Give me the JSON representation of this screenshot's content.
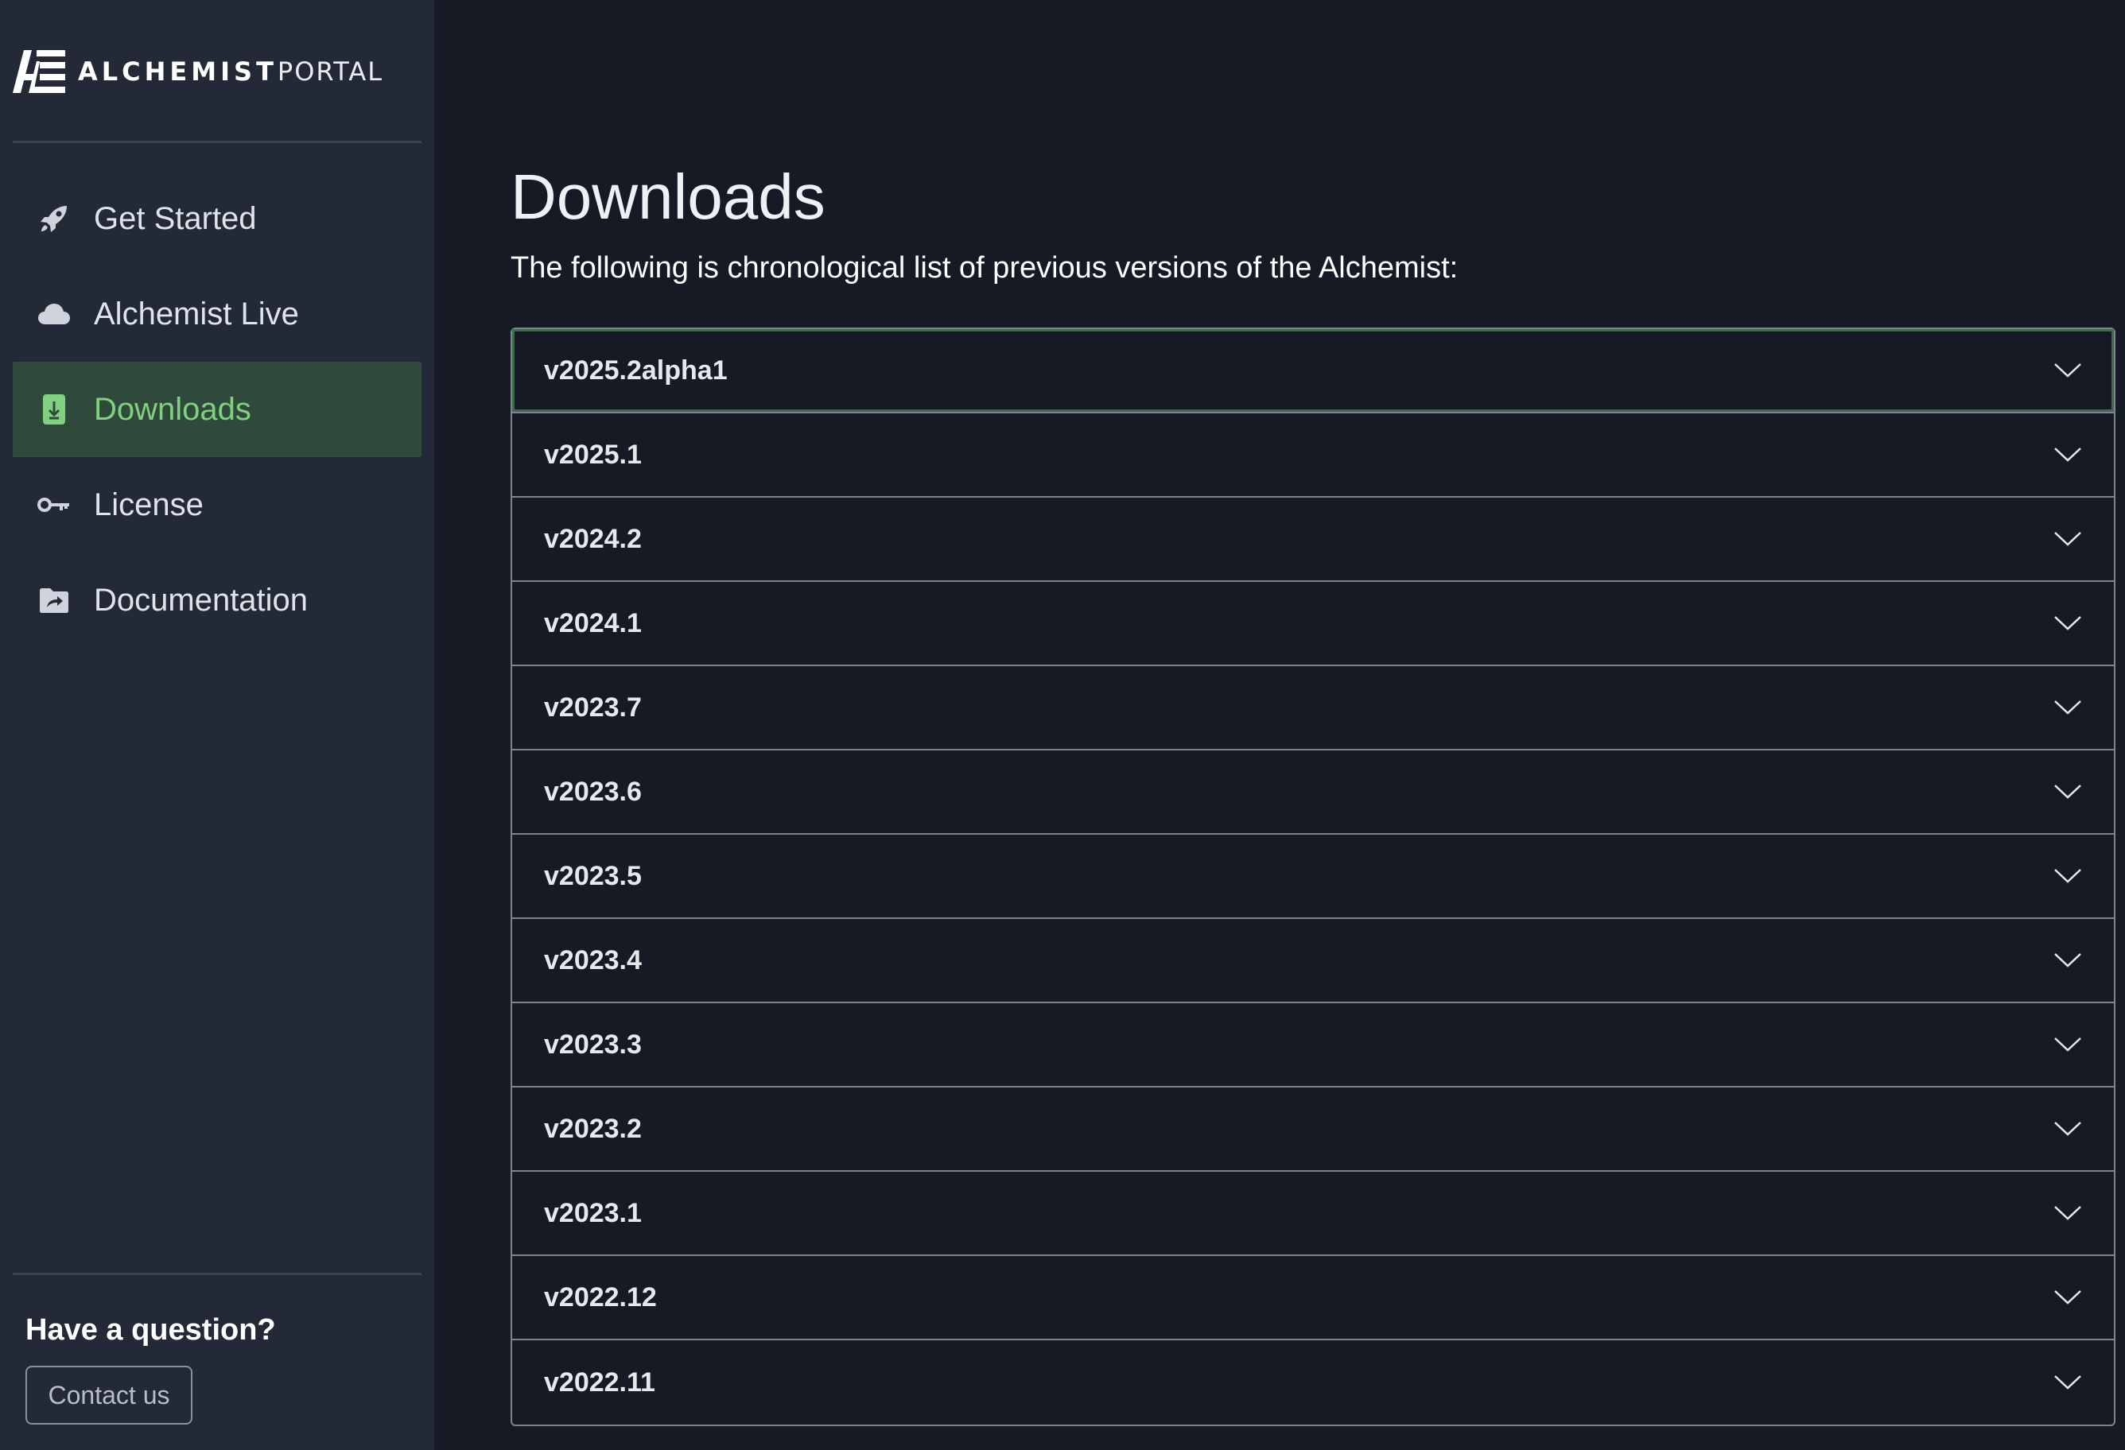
{
  "brand": {
    "name_strong": "ALCHEMIST",
    "name_light": "PORTAL",
    "logo_icon": "alchemist-logo-icon"
  },
  "sidebar": {
    "items": [
      {
        "label": "Get Started",
        "icon": "rocket-icon",
        "active": false
      },
      {
        "label": "Alchemist Live",
        "icon": "cloud-icon",
        "active": false
      },
      {
        "label": "Downloads",
        "icon": "download-file-icon",
        "active": true
      },
      {
        "label": "License",
        "icon": "key-icon",
        "active": false
      },
      {
        "label": "Documentation",
        "icon": "folder-share-icon",
        "active": false
      }
    ],
    "question": "Have a question?",
    "contact_label": "Contact us"
  },
  "main": {
    "title": "Downloads",
    "subtitle": "The following is chronological list of previous versions of the Alchemist:",
    "versions": [
      "v2025.2alpha1",
      "v2025.1",
      "v2024.2",
      "v2024.1",
      "v2023.7",
      "v2023.6",
      "v2023.5",
      "v2023.4",
      "v2023.3",
      "v2023.2",
      "v2023.1",
      "v2022.12",
      "v2022.11"
    ],
    "expand_icon": "chevron-down-icon"
  },
  "colors": {
    "sidebar_bg": "#232936",
    "main_bg": "#151a25",
    "active_bg": "#2f4a3b",
    "active_text": "#7fd17f",
    "border": "#7f858f"
  }
}
